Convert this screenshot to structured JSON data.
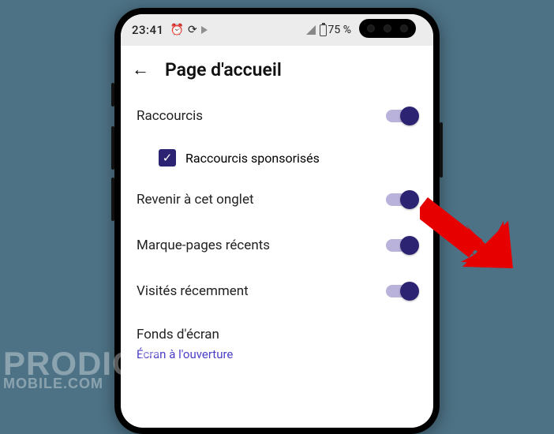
{
  "statusbar": {
    "time": "23:41",
    "battery_pct": "75 %"
  },
  "header": {
    "title": "Page d'accueil"
  },
  "settings": {
    "shortcuts": {
      "label": "Raccourcis",
      "on": true
    },
    "sponsored": {
      "label": "Raccourcis sponsorisés",
      "checked": true
    },
    "return_tab": {
      "label": "Revenir à cet onglet",
      "on": true
    },
    "recent_bookmarks": {
      "label": "Marque-pages récents",
      "on": true
    },
    "recently_visited": {
      "label": "Visités récemment",
      "on": true
    },
    "wallpapers_section": "Fonds d'écran",
    "opening_screen_link": "Écran à l'ouverture"
  },
  "watermark": {
    "line1": "PRODIGE",
    "line2": "MOBILE",
    "suffix": ".COM"
  }
}
